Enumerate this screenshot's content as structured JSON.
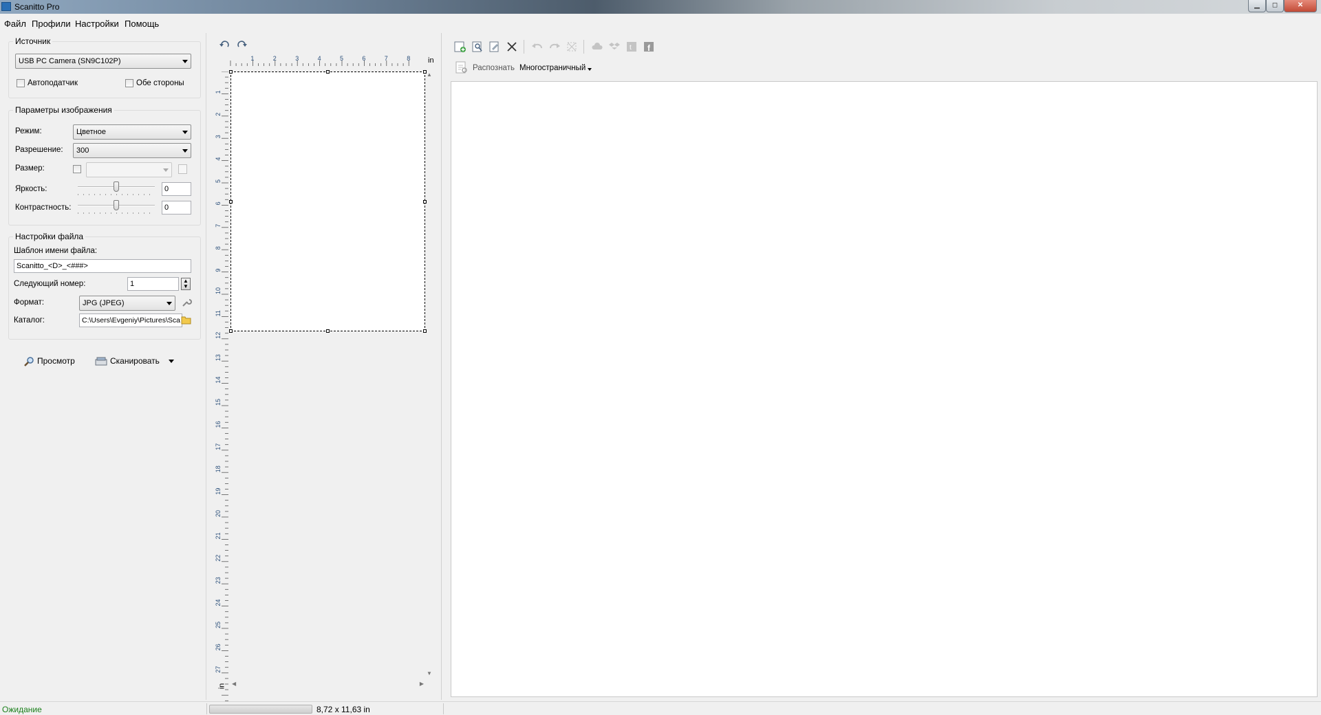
{
  "window": {
    "title": "Scanitto Pro"
  },
  "menu": [
    "Файл",
    "Профили",
    "Настройки",
    "Помощь"
  ],
  "source": {
    "title": "Источник",
    "device": "USB PC Camera (SN9C102P)",
    "autofeeder_label": "Автоподатчик",
    "autofeeder_checked": false,
    "duplex_label": "Обе стороны",
    "duplex_checked": false
  },
  "image_params": {
    "title": "Параметры изображения",
    "mode_label": "Режим:",
    "mode_value": "Цветное",
    "resolution_label": "Разрешение:",
    "resolution_value": "300",
    "size_label": "Размер:",
    "size_value": "",
    "size_checked": false,
    "brightness_label": "Яркость:",
    "brightness_value": "0",
    "contrast_label": "Контрастность:",
    "contrast_value": "0"
  },
  "file_settings": {
    "title": "Настройки файла",
    "template_label": "Шаблон имени файла:",
    "template_value": "Scanitto_<D>_<###>",
    "next_number_label": "Следующий номер:",
    "next_number_value": "1",
    "format_label": "Формат:",
    "format_value": "JPG (JPEG)",
    "folder_label": "Каталог:",
    "folder_value": "C:\\Users\\Evgeniy\\Pictures\\Sca"
  },
  "actions": {
    "preview_label": "Просмотр",
    "scan_label": "Сканировать"
  },
  "ruler": {
    "unit": "in",
    "h_ticks": [
      "1",
      "2",
      "3",
      "4",
      "5",
      "6",
      "7",
      "8"
    ],
    "v_ticks": [
      "1",
      "2",
      "3",
      "4",
      "5",
      "6",
      "7",
      "8",
      "9",
      "10",
      "11",
      "12",
      "13",
      "14",
      "15",
      "16",
      "17",
      "18",
      "19",
      "20",
      "21",
      "22",
      "23",
      "24",
      "25",
      "26",
      "27"
    ]
  },
  "right_toolbar": {
    "recognize_label": "Распознать",
    "multipage_label": "Многостраничный"
  },
  "status": {
    "state": "Ожидание",
    "dimensions": "8,72 x 11,63 in",
    "state_color": "#1a7f1a"
  },
  "icons": {
    "preview": "magnifier-icon",
    "scan": "scanner-icon",
    "folder": "folder-icon",
    "wrench": "wrench-icon",
    "rotate_left": "rotate-left-icon",
    "rotate_right": "rotate-right-icon"
  }
}
